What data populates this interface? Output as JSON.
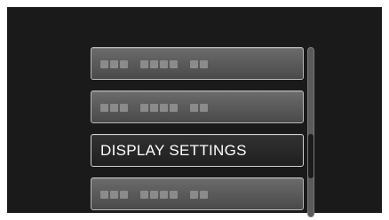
{
  "menu": {
    "items": [
      {
        "label": "",
        "blurred": true
      },
      {
        "label": "",
        "blurred": true
      },
      {
        "label": "DISPLAY SETTINGS",
        "blurred": false,
        "selected": true
      },
      {
        "label": "",
        "blurred": true
      }
    ]
  },
  "scrollbar": {
    "thumb_position": 0.55
  },
  "colors": {
    "screen_bg": "#1a1a1a",
    "item_bg": "#5a5a5a",
    "item_selected_bg": "#262626",
    "item_border": "#b8b8b8",
    "text": "#ffffff"
  }
}
